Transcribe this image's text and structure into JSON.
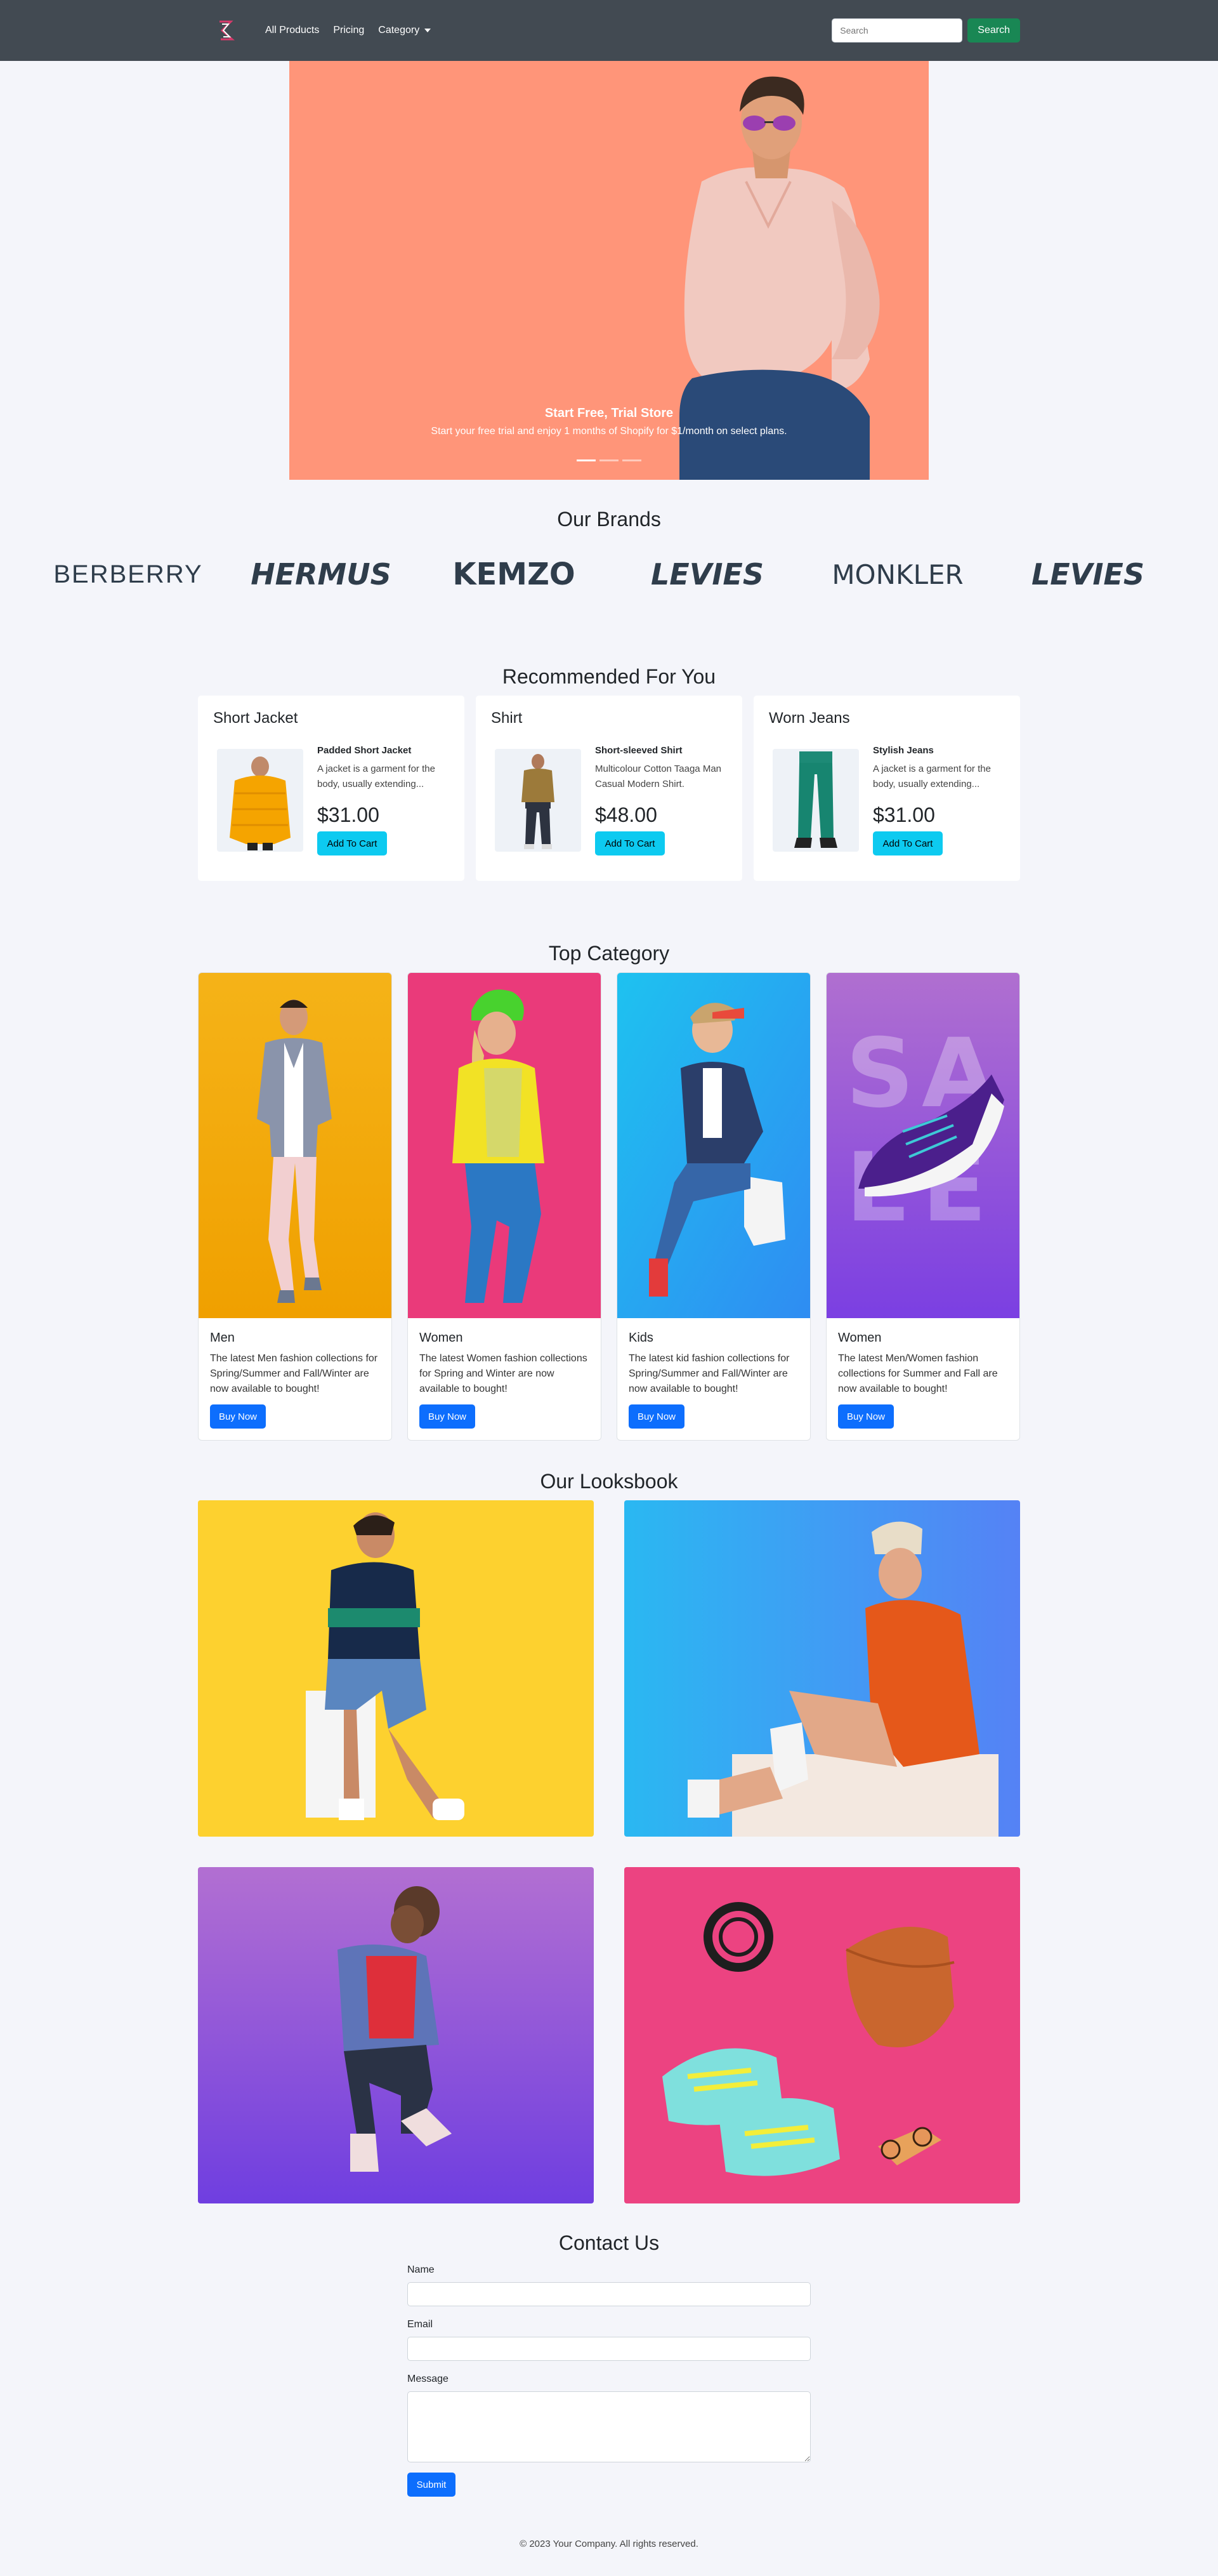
{
  "nav": {
    "links": [
      "All Products",
      "Pricing",
      "Category"
    ],
    "search_placeholder": "Search",
    "search_button": "Search"
  },
  "hero": {
    "title": "Start Free, Trial Store",
    "subtitle": "Start your free trial and enjoy 1 months of Shopify for $1/month on select plans."
  },
  "brands": {
    "title": "Our Brands",
    "items": [
      "BERBERRY",
      "HERMUS",
      "KEMZO",
      "LEVIES",
      "MONKLER",
      "LEVIES"
    ]
  },
  "recommended": {
    "title": "Recommended For You",
    "items": [
      {
        "title": "Short Jacket",
        "name": "Padded Short Jacket",
        "desc": "A jacket is a garment for the body, usually extending...",
        "price": "$31.00",
        "button": "Add To Cart"
      },
      {
        "title": "Shirt",
        "name": "Short-sleeved Shirt",
        "desc": "Multicolour Cotton Taaga Man Casual Modern Shirt.",
        "price": "$48.00",
        "button": "Add To Cart"
      },
      {
        "title": "Worn Jeans",
        "name": "Stylish Jeans",
        "desc": "A jacket is a garment for the body, usually extending...",
        "price": "$31.00",
        "button": "Add To Cart"
      }
    ]
  },
  "categories": {
    "title": "Top Category",
    "items": [
      {
        "title": "Men",
        "desc": "The latest Men fashion collections for Spring/Summer and Fall/Winter are now available to bought!",
        "button": "Buy Now"
      },
      {
        "title": "Women",
        "desc": "The latest Women fashion collections for Spring and Winter are now available to bought!",
        "button": "Buy Now"
      },
      {
        "title": "Kids",
        "desc": "The latest kid fashion collections for Spring/Summer and Fall/Winter are now available to bought!",
        "button": "Buy Now"
      },
      {
        "title": "Women",
        "desc": "The latest Men/Women fashion collections for Summer and Fall are now available to bought!",
        "button": "Buy Now"
      }
    ]
  },
  "lookbook": {
    "title": "Our Looksbook"
  },
  "contact": {
    "title": "Contact Us",
    "name_label": "Name",
    "email_label": "Email",
    "message_label": "Message",
    "submit": "Submit"
  },
  "footer": {
    "text": "© 2023 Your Company. All rights reserved."
  },
  "colors": {
    "navbar": "#424a52",
    "success": "#198754",
    "primary": "#0d6efd",
    "info": "#0dcaf0",
    "hero_bg": "#ff9579"
  }
}
